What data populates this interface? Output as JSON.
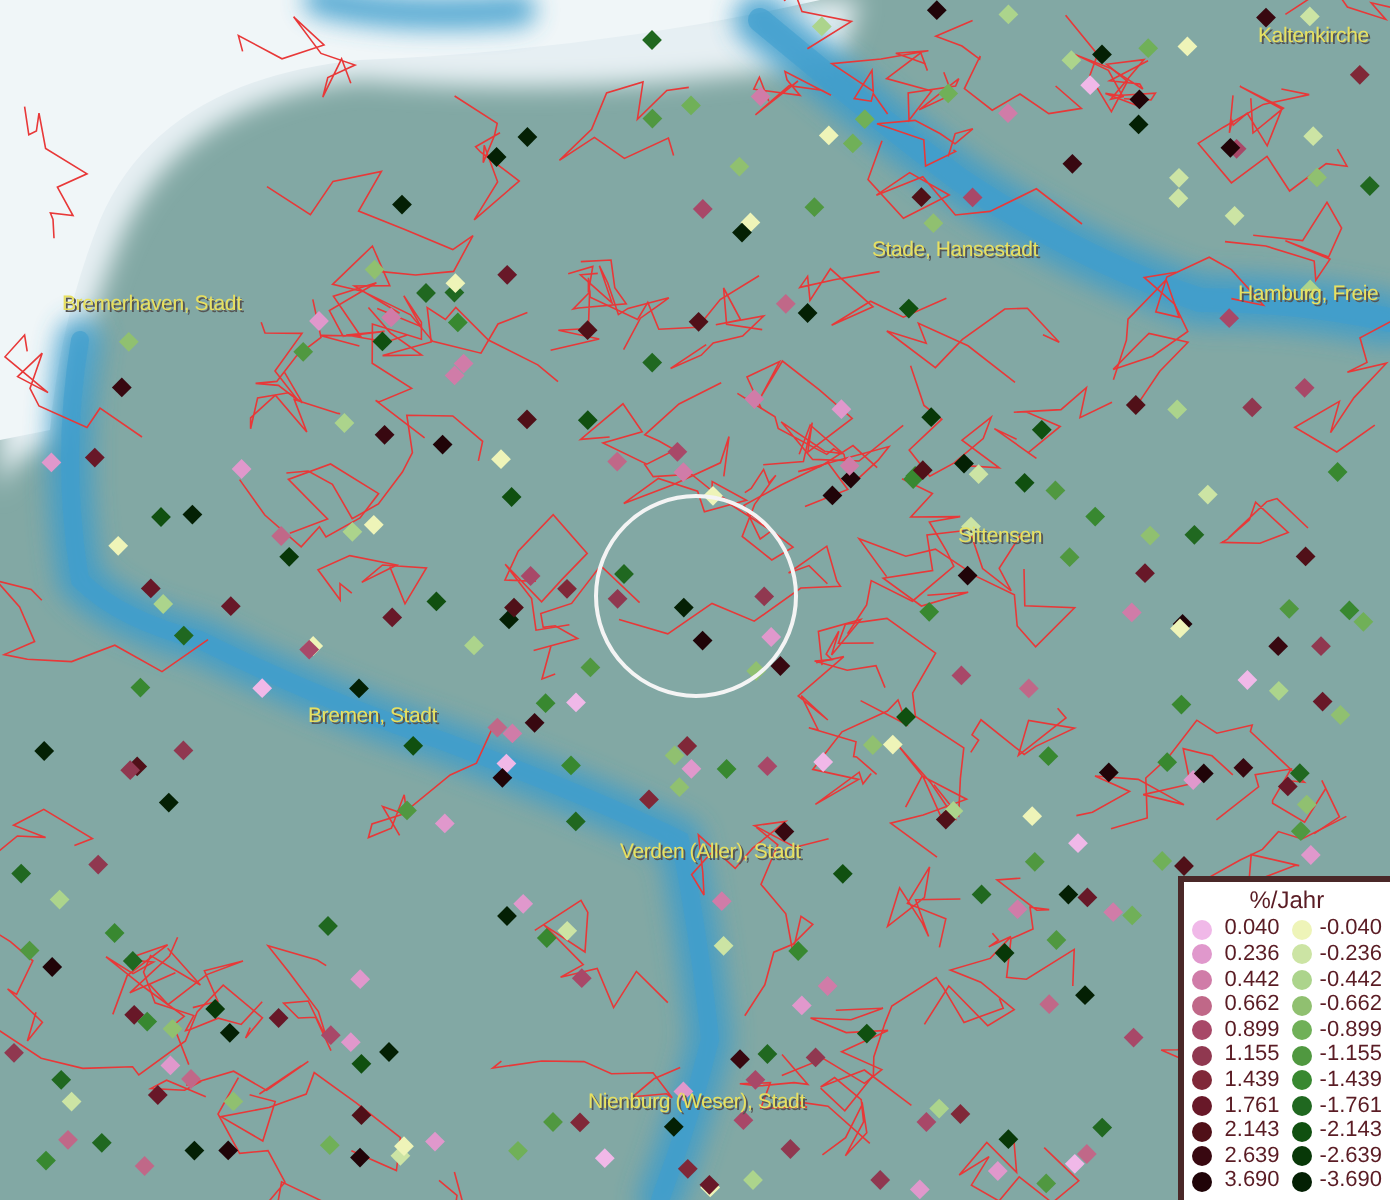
{
  "map": {
    "places": [
      {
        "name": "Kaltenkirche"
      },
      {
        "name": "Stade, Hansestadt"
      },
      {
        "name": "Hamburg, Freie"
      },
      {
        "name": "Bremerhaven, Stadt"
      },
      {
        "name": "Sittensen"
      },
      {
        "name": "Bremen, Stadt"
      },
      {
        "name": "Verden (Aller), Stadt"
      },
      {
        "name": "Nienburg (Weser), Stadt"
      }
    ]
  },
  "legend": {
    "title": "%/Jahr",
    "positive": [
      {
        "label": "0.040",
        "color": "#f0b8e8"
      },
      {
        "label": "0.236",
        "color": "#e098cc"
      },
      {
        "label": "0.442",
        "color": "#d07ca8"
      },
      {
        "label": "0.662",
        "color": "#c06888"
      },
      {
        "label": "0.899",
        "color": "#a84868"
      },
      {
        "label": "1.155",
        "color": "#903850"
      },
      {
        "label": "1.439",
        "color": "#802838"
      },
      {
        "label": "1.761",
        "color": "#681828"
      },
      {
        "label": "2.143",
        "color": "#501018"
      },
      {
        "label": "2.639",
        "color": "#380810"
      },
      {
        "label": "3.690",
        "color": "#200408"
      }
    ],
    "negative": [
      {
        "label": "-0.040",
        "color": "#eef4b8"
      },
      {
        "label": "-0.236",
        "color": "#cce4a4"
      },
      {
        "label": "-0.442",
        "color": "#acd48c"
      },
      {
        "label": "-0.662",
        "color": "#90c070"
      },
      {
        "label": "-0.899",
        "color": "#70b058"
      },
      {
        "label": "-1.155",
        "color": "#509840"
      },
      {
        "label": "-1.439",
        "color": "#388830"
      },
      {
        "label": "-1.761",
        "color": "#206820"
      },
      {
        "label": "-2.143",
        "color": "#105010"
      },
      {
        "label": "-2.639",
        "color": "#083808"
      },
      {
        "label": "-3.690",
        "color": "#042004"
      }
    ]
  }
}
